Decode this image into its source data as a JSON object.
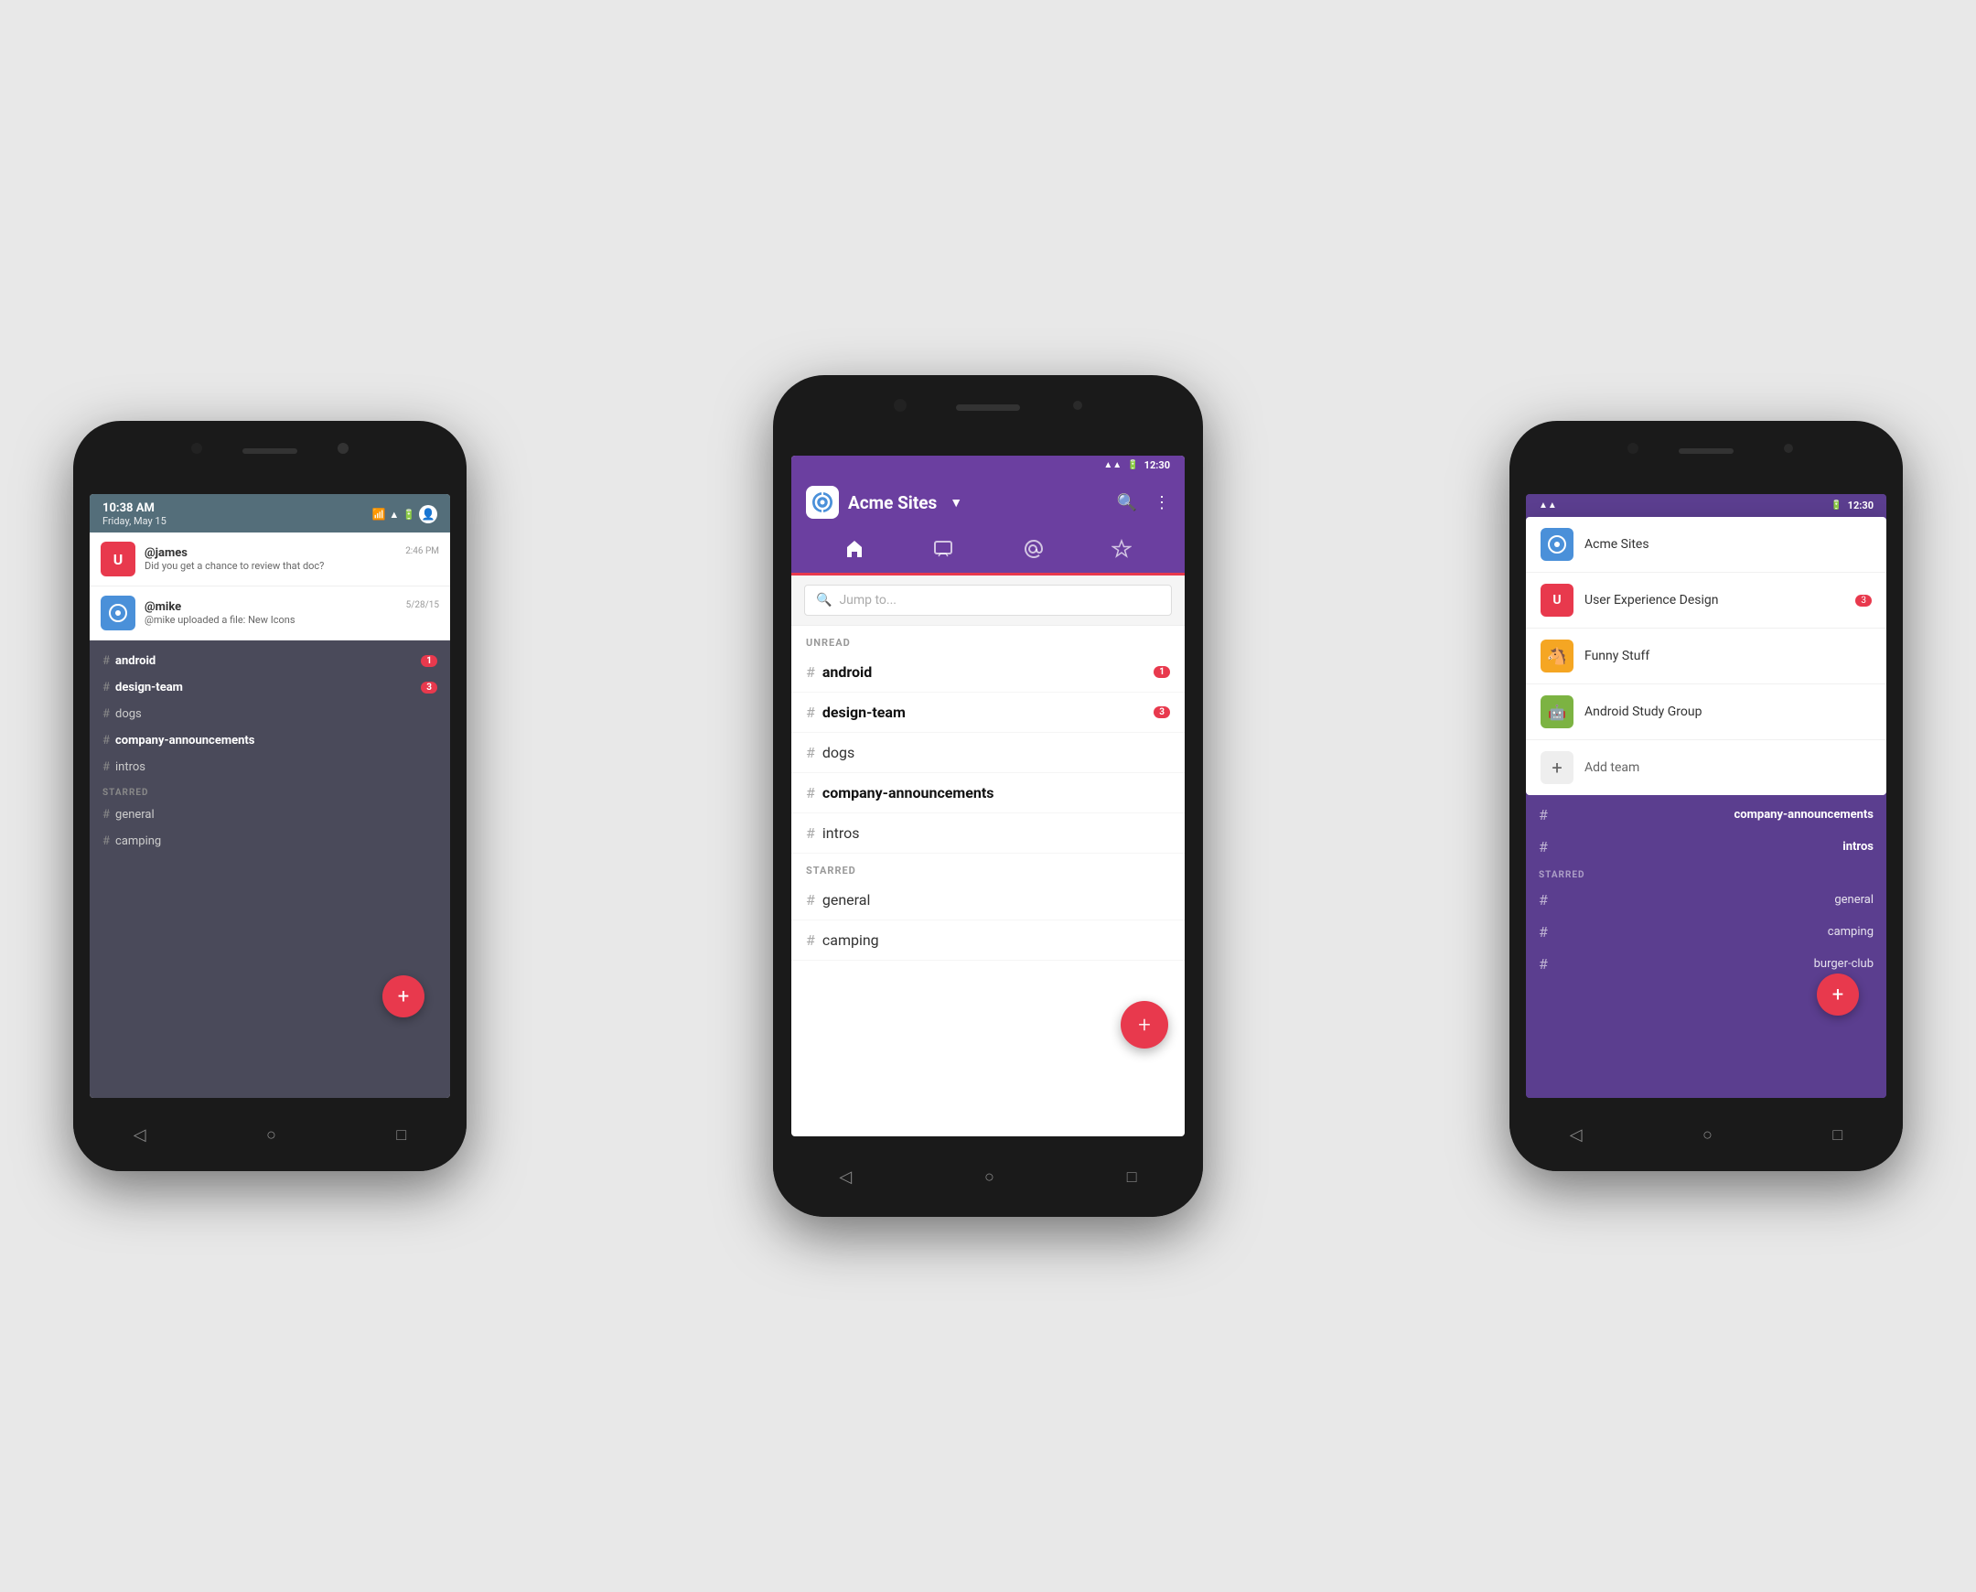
{
  "left_phone": {
    "status_bar": {
      "time": "10:38 AM",
      "date": "Friday, May 15"
    },
    "notifications": [
      {
        "user": "@james",
        "time": "2:46 PM",
        "message": "Did you get a chance to review that doc?",
        "avatar_color": "#e8394d",
        "avatar_letter": "U"
      },
      {
        "user": "@mike",
        "time": "5/28/15",
        "message": "@mike uploaded a file: New Icons",
        "avatar_color": "#4a90d9",
        "avatar_letter": "◎"
      }
    ],
    "channels": [
      {
        "name": "android",
        "bold": true,
        "badge": "1"
      },
      {
        "name": "design-team",
        "bold": true,
        "badge": "3"
      },
      {
        "name": "dogs",
        "bold": false,
        "badge": ""
      },
      {
        "name": "company-announcements",
        "bold": true,
        "badge": ""
      },
      {
        "name": "intros",
        "bold": false,
        "badge": ""
      }
    ],
    "starred_label": "STARRED",
    "starred": [
      {
        "name": "general",
        "bold": false
      },
      {
        "name": "camping",
        "bold": false
      }
    ],
    "fab_label": "+"
  },
  "center_phone": {
    "status_bar": {
      "time": "12:30"
    },
    "header": {
      "title": "Acme Sites",
      "dropdown_icon": "▼",
      "search_icon": "🔍",
      "more_icon": "⋮"
    },
    "tabs": [
      {
        "icon": "⌂",
        "active": true
      },
      {
        "icon": "💬",
        "active": false
      },
      {
        "icon": "@",
        "active": false
      },
      {
        "icon": "☆",
        "active": false
      }
    ],
    "search_placeholder": "Jump to...",
    "unread_label": "UNREAD",
    "channels_unread": [
      {
        "name": "android",
        "bold": true,
        "badge": "1"
      },
      {
        "name": "design-team",
        "bold": true,
        "badge": "3"
      },
      {
        "name": "dogs",
        "bold": false,
        "badge": ""
      },
      {
        "name": "company-announcements",
        "bold": true,
        "badge": ""
      },
      {
        "name": "intros",
        "bold": false,
        "badge": ""
      }
    ],
    "starred_label": "STARRED",
    "starred": [
      {
        "name": "general",
        "bold": false
      },
      {
        "name": "camping",
        "bold": false
      }
    ],
    "fab_label": "+"
  },
  "right_phone": {
    "status_bar": {
      "time": "12:30"
    },
    "dropdown": {
      "items": [
        {
          "name": "Acme Sites",
          "avatar_color": "#4a90d9",
          "avatar_letter": "◎",
          "badge": ""
        },
        {
          "name": "User Experience Design",
          "avatar_color": "#e8394d",
          "avatar_letter": "U",
          "badge": "3"
        },
        {
          "name": "Funny Stuff",
          "avatar_color": "#f5a623",
          "avatar_letter": "🐴",
          "badge": ""
        },
        {
          "name": "Android Study Group",
          "avatar_color": "#7cb342",
          "avatar_letter": "🤖",
          "badge": ""
        },
        {
          "name": "Add team",
          "avatar_color": "#eee",
          "avatar_letter": "+",
          "is_add": true,
          "badge": ""
        }
      ]
    },
    "channels": [
      {
        "name": "company-announcements",
        "bold": true
      },
      {
        "name": "intros",
        "bold": true
      }
    ],
    "starred_label": "STARRED",
    "starred": [
      {
        "name": "general",
        "bold": false
      },
      {
        "name": "camping",
        "bold": false
      },
      {
        "name": "burger-club",
        "bold": false
      }
    ],
    "fab_label": "+"
  }
}
